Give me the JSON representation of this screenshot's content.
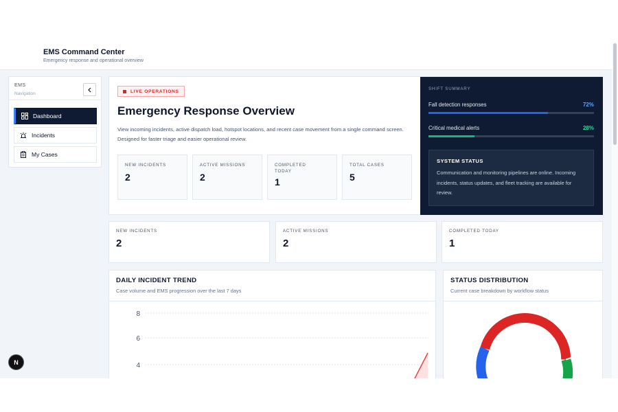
{
  "header": {
    "title": "EMS Command Center",
    "subtitle": "Emergency response and operational overview"
  },
  "sidebar": {
    "title": "EMS",
    "subtitle": "Navigation",
    "collapse_icon": "chevron-left-icon",
    "items": [
      {
        "label": "Dashboard",
        "icon": "dashboard-grid-icon",
        "active": true
      },
      {
        "label": "Incidents",
        "icon": "siren-icon",
        "active": false
      },
      {
        "label": "My Cases",
        "icon": "clipboard-icon",
        "active": false
      }
    ]
  },
  "hero": {
    "badge": "LIVE OPERATIONS",
    "title": "Emergency Response Overview",
    "description": "View incoming incidents, active dispatch load, hotspot locations, and recent case movement from a single command screen. Designed for faster triage and easier operational review.",
    "stats": [
      {
        "label": "NEW INCIDENTS",
        "value": "2"
      },
      {
        "label": "ACTIVE MISSIONS",
        "value": "2"
      },
      {
        "label": "COMPLETED TODAY",
        "value": "1"
      },
      {
        "label": "TOTAL CASES",
        "value": "5"
      }
    ]
  },
  "shift_summary": {
    "label": "SHIFT SUMMARY",
    "items": [
      {
        "label": "Fall detection responses",
        "value_text": "72%",
        "value": 0.72,
        "color": "#2563eb",
        "text_color": "#60a5fa"
      },
      {
        "label": "Critical medical alerts",
        "value_text": "28%",
        "value": 0.28,
        "color": "#10b981",
        "text_color": "#34d399"
      }
    ],
    "system_status": {
      "title": "SYSTEM STATUS",
      "text": "Communication and monitoring pipelines are online. Incoming incidents, status updates, and fleet tracking are available for review."
    }
  },
  "stat_cards": [
    {
      "label": "NEW INCIDENTS",
      "value": "2"
    },
    {
      "label": "ACTIVE MISSIONS",
      "value": "2"
    },
    {
      "label": "COMPLETED TODAY",
      "value": "1"
    }
  ],
  "trend": {
    "title": "DAILY INCIDENT TREND",
    "subtitle": "Case volume and EMS progression over the last 7 days"
  },
  "status_distribution": {
    "title": "STATUS DISTRIBUTION",
    "subtitle": "Current case breakdown by workflow status"
  },
  "chart_data": [
    {
      "type": "line",
      "title": "DAILY INCIDENT TREND",
      "y_ticks": [
        "8",
        "6",
        "4"
      ],
      "ylim": [
        0,
        8
      ],
      "grid": true,
      "series_color": "#ef4444"
    },
    {
      "type": "pie",
      "title": "STATUS DISTRIBUTION",
      "visible_colors": [
        "#dc2626",
        "#2563eb",
        "#16a34a"
      ]
    }
  ],
  "next_badge": "N",
  "colors": {
    "navy": "#0f1b33",
    "accent_blue": "#2563eb",
    "alert_red": "#dc2626",
    "success_green": "#10b981"
  }
}
